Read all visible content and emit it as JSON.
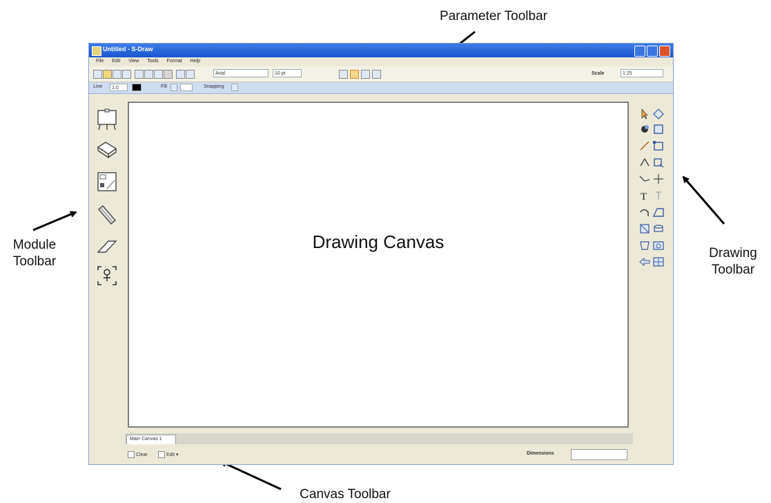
{
  "annotations": {
    "parameter_toolbar": "Parameter Toolbar",
    "module_toolbar_line1": "Module",
    "module_toolbar_line2": "Toolbar",
    "drawing_toolbar_line1": "Drawing",
    "drawing_toolbar_line2": "Toolbar",
    "canvas_toolbar": "Canvas Toolbar"
  },
  "window": {
    "title": "Untitled - S-Draw",
    "menu": [
      "File",
      "Edit",
      "View",
      "Tools",
      "Format",
      "Help"
    ]
  },
  "parameter_toolbar": {
    "font_value": "Arial",
    "font_size_value": "10 pt",
    "scale_label": "Scale",
    "scale_value": "1:25"
  },
  "property_bar": {
    "line_label": "Line",
    "line_value": "1.0",
    "fill_label": "Fill",
    "snapping_label": "Snapping"
  },
  "canvas": {
    "label": "Drawing Canvas",
    "tab_label": "Main Canvas 1"
  },
  "canvas_toolbar": {
    "clear_label": "Clear",
    "edit_label": "Edit",
    "dimensions_label": "Dimensions"
  },
  "colors": {
    "titlebar": "#1a55cf",
    "chrome": "#ece9d8",
    "property_bar": "#cfdcf0"
  }
}
